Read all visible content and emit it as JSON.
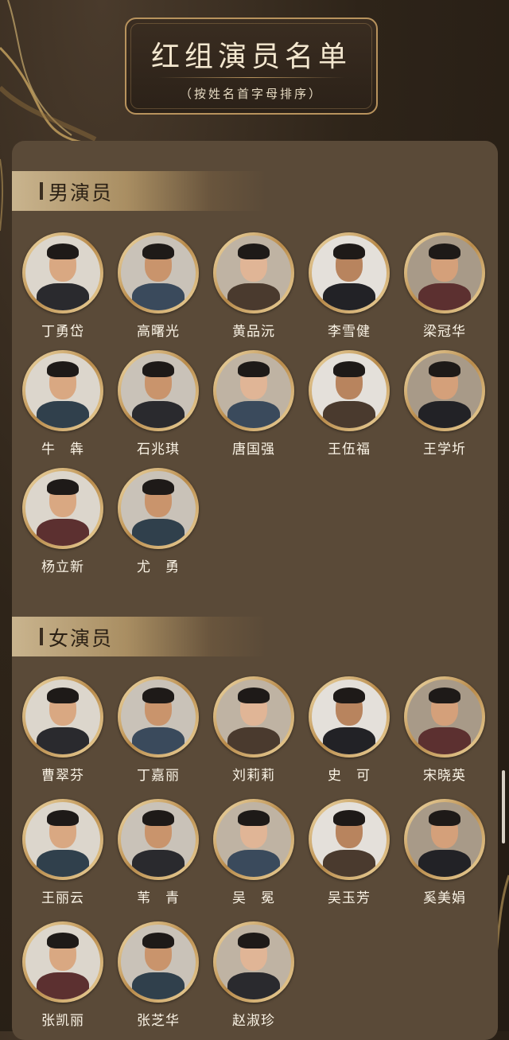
{
  "header": {
    "title": "红组演员名单",
    "subtitle": "（按姓名首字母排序）"
  },
  "sections": [
    {
      "heading": "男演员",
      "actors": [
        {
          "name": "丁勇岱"
        },
        {
          "name": "高曙光"
        },
        {
          "name": "黄品沅"
        },
        {
          "name": "李雪健"
        },
        {
          "name": "梁冠华"
        },
        {
          "name": "牛　犇"
        },
        {
          "name": "石兆琪"
        },
        {
          "name": "唐国强"
        },
        {
          "name": "王伍福"
        },
        {
          "name": "王学圻"
        },
        {
          "name": "杨立新"
        },
        {
          "name": "尤　勇"
        }
      ]
    },
    {
      "heading": "女演员",
      "actors": [
        {
          "name": "曹翠芬"
        },
        {
          "name": "丁嘉丽"
        },
        {
          "name": "刘莉莉"
        },
        {
          "name": "史　可"
        },
        {
          "name": "宋晓英"
        },
        {
          "name": "王丽云"
        },
        {
          "name": "苇　青"
        },
        {
          "name": "吴　冕"
        },
        {
          "name": "吴玉芳"
        },
        {
          "name": "奚美娟"
        },
        {
          "name": "张凯丽"
        },
        {
          "name": "张芝华"
        },
        {
          "name": "赵淑珍"
        }
      ]
    }
  ],
  "colors": {
    "background": "#2e2419",
    "panel": "#5a4a38",
    "gold": "#b8935d",
    "name_text": "#fbf4e6"
  }
}
